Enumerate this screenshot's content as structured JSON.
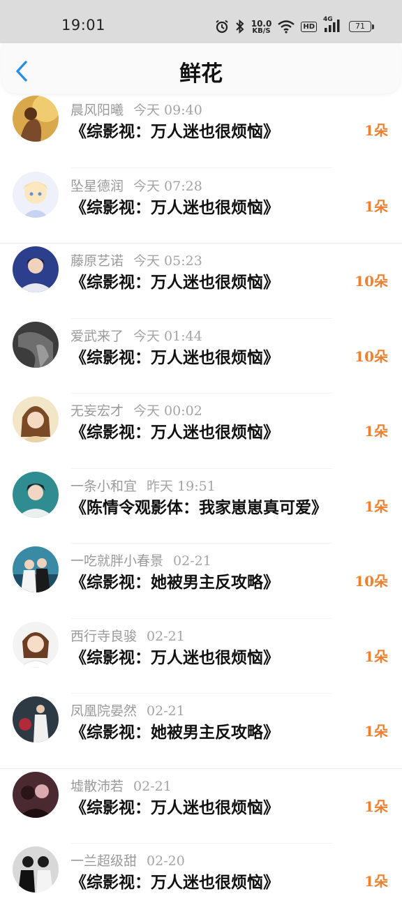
{
  "status_bar": {
    "time": "19:01",
    "net_speed_value": "10.0",
    "net_speed_unit": "KB/S",
    "hd_label": "HD",
    "signal_label": "4G",
    "battery": "71"
  },
  "header": {
    "title": "鲜花"
  },
  "colors": {
    "count": "#f08030",
    "meta": "#9a9a9a"
  },
  "items": [
    {
      "user": "晨风阳曦",
      "time": "今天 09:40",
      "book": "《综影视：万人迷也很烦恼》",
      "count": "1朵"
    },
    {
      "user": "坠星德润",
      "time": "今天 07:28",
      "book": "《综影视：万人迷也很烦恼》",
      "count": "1朵"
    },
    {
      "user": "藤原艺诺",
      "time": "今天 05:23",
      "book": "《综影视：万人迷也很烦恼》",
      "count": "10朵"
    },
    {
      "user": "爱武来了",
      "time": "今天 01:44",
      "book": "《综影视：万人迷也很烦恼》",
      "count": "10朵"
    },
    {
      "user": "无妄宏才",
      "time": "今天 00:02",
      "book": "《综影视：万人迷也很烦恼》",
      "count": "1朵"
    },
    {
      "user": "一条小和宜",
      "time": "昨天 19:51",
      "book": "《陈情令观影体：我家崽崽真可爱》",
      "count": "1朵"
    },
    {
      "user": "一吃就胖小春景",
      "time": "02-21",
      "book": "《综影视：她被男主反攻略》",
      "count": "10朵"
    },
    {
      "user": "西行寺良骏",
      "time": "02-21",
      "book": "《综影视：万人迷也很烦恼》",
      "count": "1朵"
    },
    {
      "user": "凤凰院晏然",
      "time": "02-21",
      "book": "《综影视：她被男主反攻略》",
      "count": "1朵"
    },
    {
      "user": "墟散沛若",
      "time": "02-21",
      "book": "《综影视：万人迷也很烦恼》",
      "count": "1朵"
    },
    {
      "user": "一兰超级甜",
      "time": "02-20",
      "book": "《综影视：万人迷也很烦恼》",
      "count": "1朵"
    }
  ]
}
